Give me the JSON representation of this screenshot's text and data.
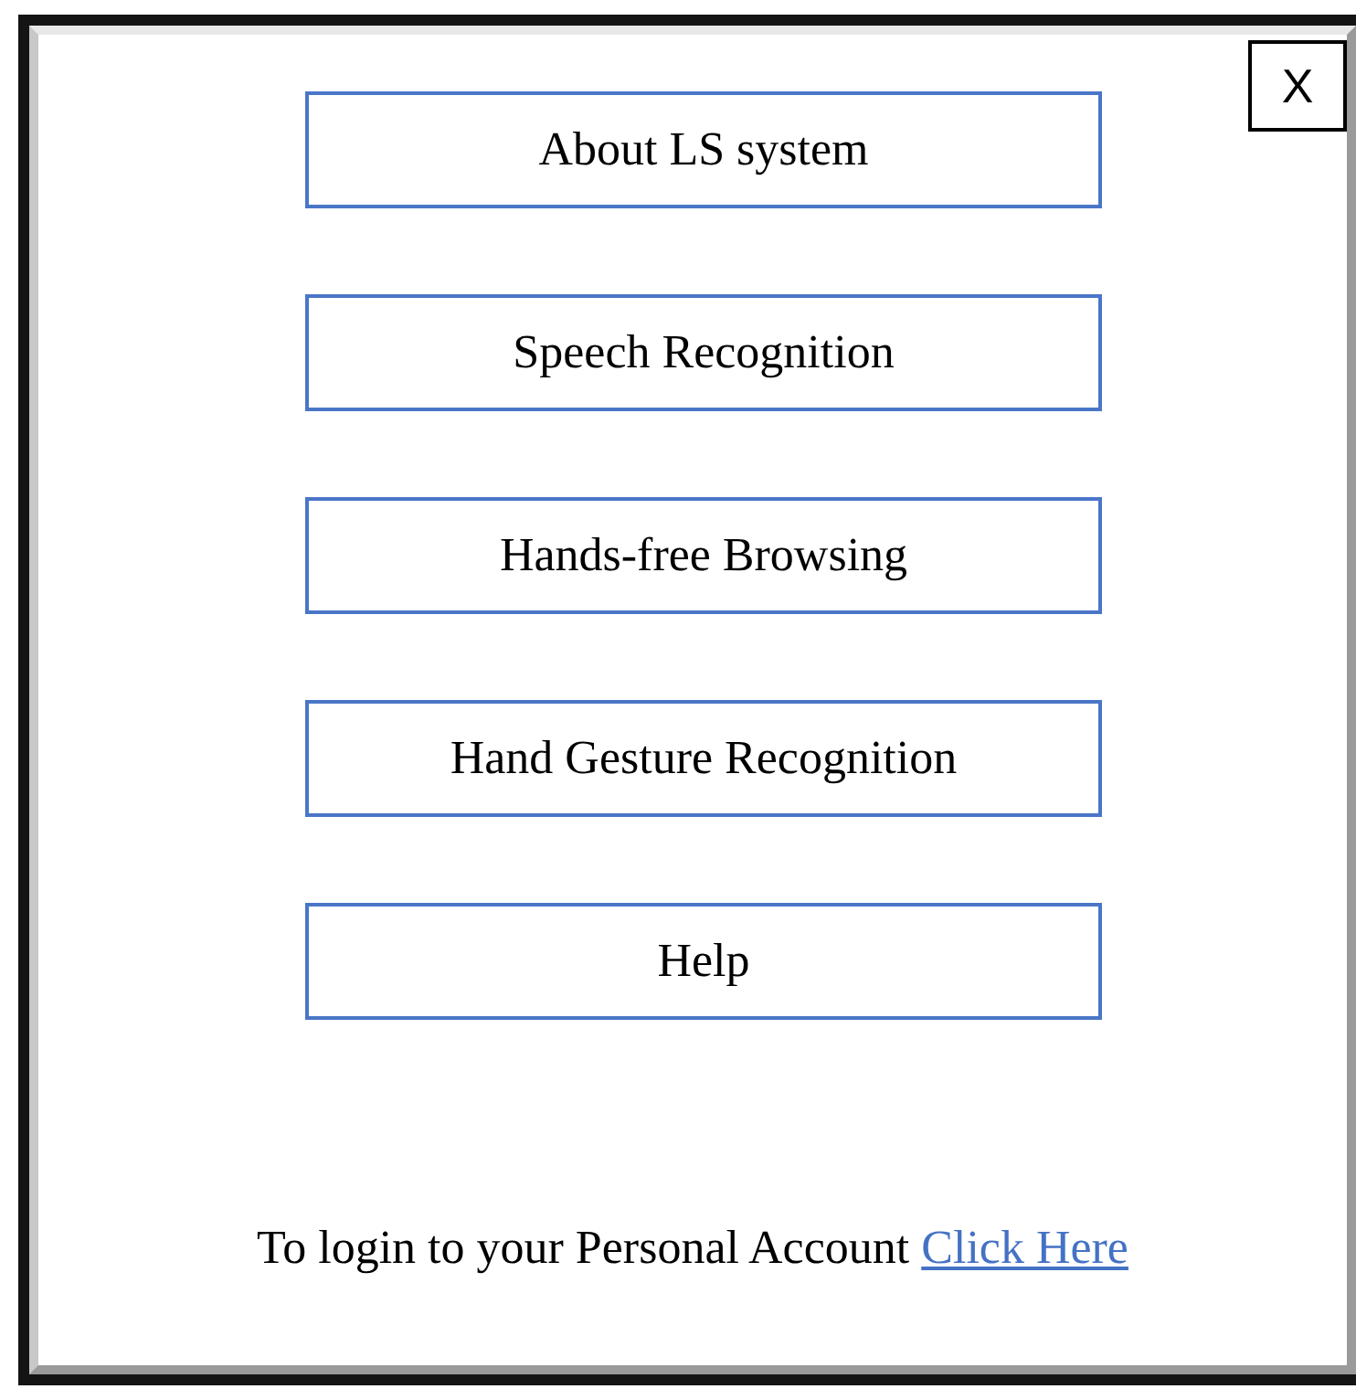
{
  "close_button": {
    "label": "X"
  },
  "menu_buttons": [
    {
      "label": "About LS system"
    },
    {
      "label": "Speech Recognition"
    },
    {
      "label": "Hands-free Browsing"
    },
    {
      "label": "Hand Gesture Recognition"
    },
    {
      "label": "Help"
    }
  ],
  "footer": {
    "text": "To login to your Personal Account",
    "link": "Click Here"
  }
}
